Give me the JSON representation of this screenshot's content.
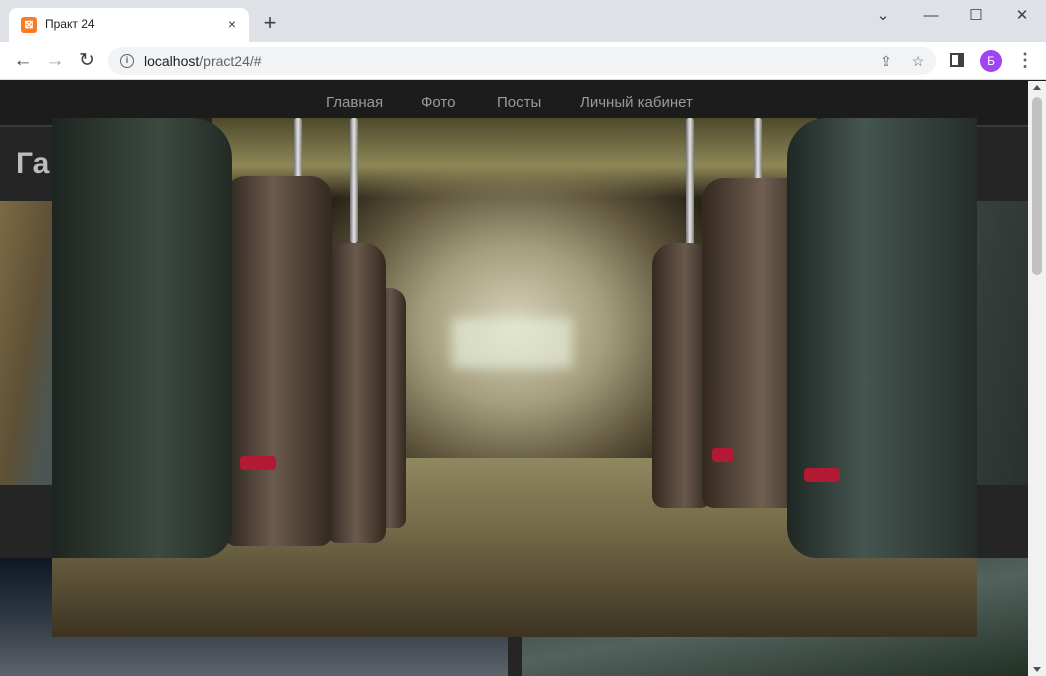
{
  "browser": {
    "tab_title": "Практ 24",
    "tab_favicon": "xampp-icon",
    "tab_close": "×",
    "new_tab": "+",
    "url_host": "localhost",
    "url_path": "/pract24/#",
    "profile_initial": "Б",
    "window_controls": {
      "chevron": "⌄",
      "minimize": "—",
      "maximize": "☐",
      "close": "✕"
    },
    "icons": {
      "back": "←",
      "forward": "→",
      "reload": "↻",
      "info": "i",
      "share": "⇪",
      "star": "☆",
      "menu": "⋮"
    }
  },
  "site": {
    "nav": [
      "Главная",
      "Фото",
      "Посты",
      "Личный кабинет"
    ],
    "heading": "Га"
  },
  "colors": {
    "avatar": "#a142f4",
    "page_bg": "#252525",
    "nav_bg": "#1c1c1c",
    "nav_text": "#9a9a9a",
    "cushion_red": "#b11a32"
  }
}
